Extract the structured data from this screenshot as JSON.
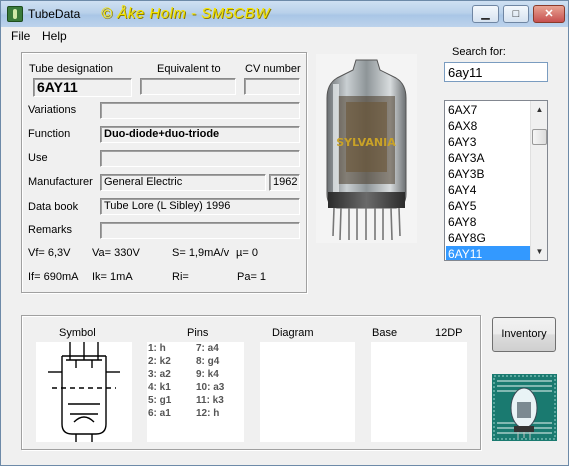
{
  "window": {
    "title": "TubeData",
    "credit": "© Åke Holm - SM5CBW",
    "min": "▁",
    "max": "□",
    "close": "✕"
  },
  "menu": {
    "file": "File",
    "help": "Help"
  },
  "labels": {
    "tube_designation": "Tube designation",
    "equivalent_to": "Equivalent to",
    "cv_number": "CV number",
    "variations": "Variations",
    "function": "Function",
    "use": "Use",
    "manufacturer": "Manufacturer",
    "data_book": "Data book",
    "remarks": "Remarks",
    "search_for": "Search for:",
    "symbol": "Symbol",
    "pins": "Pins",
    "diagram": "Diagram",
    "base": "Base",
    "base_type": "12DP"
  },
  "tube": {
    "designation": "6AY11",
    "equivalent": "",
    "cv": "",
    "variations": "",
    "function": "Duo-diode+duo-triode",
    "use": "",
    "manufacturer": "General Electric",
    "year": "1962",
    "data_book": "Tube Lore (L Sibley) 1996",
    "remarks": ""
  },
  "params": {
    "vf": "Vf= 6,3V",
    "va": "Va= 330V",
    "s": "S= 1,9mA/v",
    "mu": "µ=   0",
    "if": "If= 690mA",
    "ik": "Ik=  1mA",
    "ri": "Ri=",
    "pa": "Pa= 1"
  },
  "photo": {
    "brand": "SYLVANIA"
  },
  "search": {
    "value": "6ay11"
  },
  "list": [
    "6AX7",
    "6AX8",
    "6AY3",
    "6AY3A",
    "6AY3B",
    "6AY4",
    "6AY5",
    "6AY8",
    "6AY8G",
    "6AY11"
  ],
  "list_selected": "6AY11",
  "pins_left": [
    "1: h",
    "2: k2",
    "3: a2",
    "4: k1",
    "5: g1",
    "6: a1"
  ],
  "pins_right": [
    "7: a4",
    "8: g4",
    "9: k4",
    "10: a3",
    "11: k3",
    "12: h"
  ],
  "buttons": {
    "inventory": "Inventory"
  },
  "colors": {
    "selection": "#3399ff",
    "credit": "#f5e400"
  }
}
